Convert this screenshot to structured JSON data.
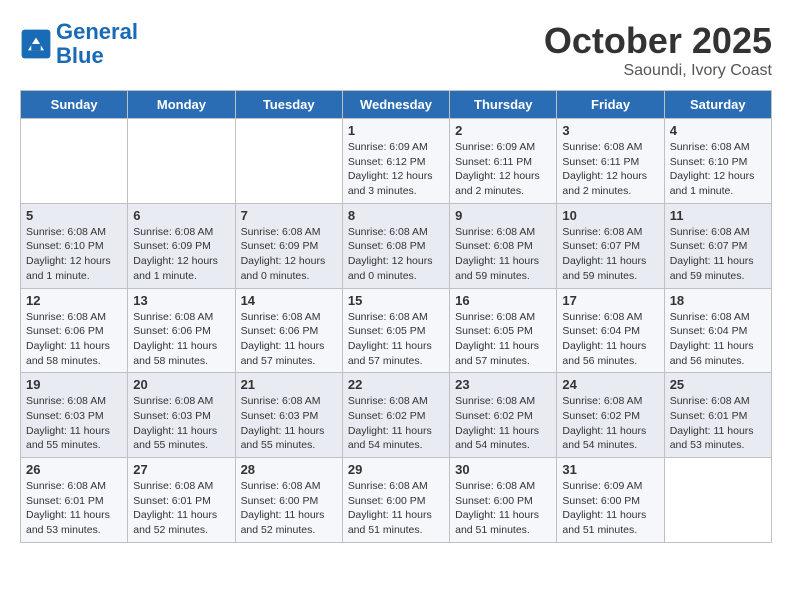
{
  "header": {
    "logo_line1": "General",
    "logo_line2": "Blue",
    "month": "October 2025",
    "location": "Saoundi, Ivory Coast"
  },
  "days_of_week": [
    "Sunday",
    "Monday",
    "Tuesday",
    "Wednesday",
    "Thursday",
    "Friday",
    "Saturday"
  ],
  "weeks": [
    [
      {
        "day": "",
        "text": ""
      },
      {
        "day": "",
        "text": ""
      },
      {
        "day": "",
        "text": ""
      },
      {
        "day": "1",
        "text": "Sunrise: 6:09 AM\nSunset: 6:12 PM\nDaylight: 12 hours and 3 minutes."
      },
      {
        "day": "2",
        "text": "Sunrise: 6:09 AM\nSunset: 6:11 PM\nDaylight: 12 hours and 2 minutes."
      },
      {
        "day": "3",
        "text": "Sunrise: 6:08 AM\nSunset: 6:11 PM\nDaylight: 12 hours and 2 minutes."
      },
      {
        "day": "4",
        "text": "Sunrise: 6:08 AM\nSunset: 6:10 PM\nDaylight: 12 hours and 1 minute."
      }
    ],
    [
      {
        "day": "5",
        "text": "Sunrise: 6:08 AM\nSunset: 6:10 PM\nDaylight: 12 hours and 1 minute."
      },
      {
        "day": "6",
        "text": "Sunrise: 6:08 AM\nSunset: 6:09 PM\nDaylight: 12 hours and 1 minute."
      },
      {
        "day": "7",
        "text": "Sunrise: 6:08 AM\nSunset: 6:09 PM\nDaylight: 12 hours and 0 minutes."
      },
      {
        "day": "8",
        "text": "Sunrise: 6:08 AM\nSunset: 6:08 PM\nDaylight: 12 hours and 0 minutes."
      },
      {
        "day": "9",
        "text": "Sunrise: 6:08 AM\nSunset: 6:08 PM\nDaylight: 11 hours and 59 minutes."
      },
      {
        "day": "10",
        "text": "Sunrise: 6:08 AM\nSunset: 6:07 PM\nDaylight: 11 hours and 59 minutes."
      },
      {
        "day": "11",
        "text": "Sunrise: 6:08 AM\nSunset: 6:07 PM\nDaylight: 11 hours and 59 minutes."
      }
    ],
    [
      {
        "day": "12",
        "text": "Sunrise: 6:08 AM\nSunset: 6:06 PM\nDaylight: 11 hours and 58 minutes."
      },
      {
        "day": "13",
        "text": "Sunrise: 6:08 AM\nSunset: 6:06 PM\nDaylight: 11 hours and 58 minutes."
      },
      {
        "day": "14",
        "text": "Sunrise: 6:08 AM\nSunset: 6:06 PM\nDaylight: 11 hours and 57 minutes."
      },
      {
        "day": "15",
        "text": "Sunrise: 6:08 AM\nSunset: 6:05 PM\nDaylight: 11 hours and 57 minutes."
      },
      {
        "day": "16",
        "text": "Sunrise: 6:08 AM\nSunset: 6:05 PM\nDaylight: 11 hours and 57 minutes."
      },
      {
        "day": "17",
        "text": "Sunrise: 6:08 AM\nSunset: 6:04 PM\nDaylight: 11 hours and 56 minutes."
      },
      {
        "day": "18",
        "text": "Sunrise: 6:08 AM\nSunset: 6:04 PM\nDaylight: 11 hours and 56 minutes."
      }
    ],
    [
      {
        "day": "19",
        "text": "Sunrise: 6:08 AM\nSunset: 6:03 PM\nDaylight: 11 hours and 55 minutes."
      },
      {
        "day": "20",
        "text": "Sunrise: 6:08 AM\nSunset: 6:03 PM\nDaylight: 11 hours and 55 minutes."
      },
      {
        "day": "21",
        "text": "Sunrise: 6:08 AM\nSunset: 6:03 PM\nDaylight: 11 hours and 55 minutes."
      },
      {
        "day": "22",
        "text": "Sunrise: 6:08 AM\nSunset: 6:02 PM\nDaylight: 11 hours and 54 minutes."
      },
      {
        "day": "23",
        "text": "Sunrise: 6:08 AM\nSunset: 6:02 PM\nDaylight: 11 hours and 54 minutes."
      },
      {
        "day": "24",
        "text": "Sunrise: 6:08 AM\nSunset: 6:02 PM\nDaylight: 11 hours and 54 minutes."
      },
      {
        "day": "25",
        "text": "Sunrise: 6:08 AM\nSunset: 6:01 PM\nDaylight: 11 hours and 53 minutes."
      }
    ],
    [
      {
        "day": "26",
        "text": "Sunrise: 6:08 AM\nSunset: 6:01 PM\nDaylight: 11 hours and 53 minutes."
      },
      {
        "day": "27",
        "text": "Sunrise: 6:08 AM\nSunset: 6:01 PM\nDaylight: 11 hours and 52 minutes."
      },
      {
        "day": "28",
        "text": "Sunrise: 6:08 AM\nSunset: 6:00 PM\nDaylight: 11 hours and 52 minutes."
      },
      {
        "day": "29",
        "text": "Sunrise: 6:08 AM\nSunset: 6:00 PM\nDaylight: 11 hours and 51 minutes."
      },
      {
        "day": "30",
        "text": "Sunrise: 6:08 AM\nSunset: 6:00 PM\nDaylight: 11 hours and 51 minutes."
      },
      {
        "day": "31",
        "text": "Sunrise: 6:09 AM\nSunset: 6:00 PM\nDaylight: 11 hours and 51 minutes."
      },
      {
        "day": "",
        "text": ""
      }
    ]
  ]
}
